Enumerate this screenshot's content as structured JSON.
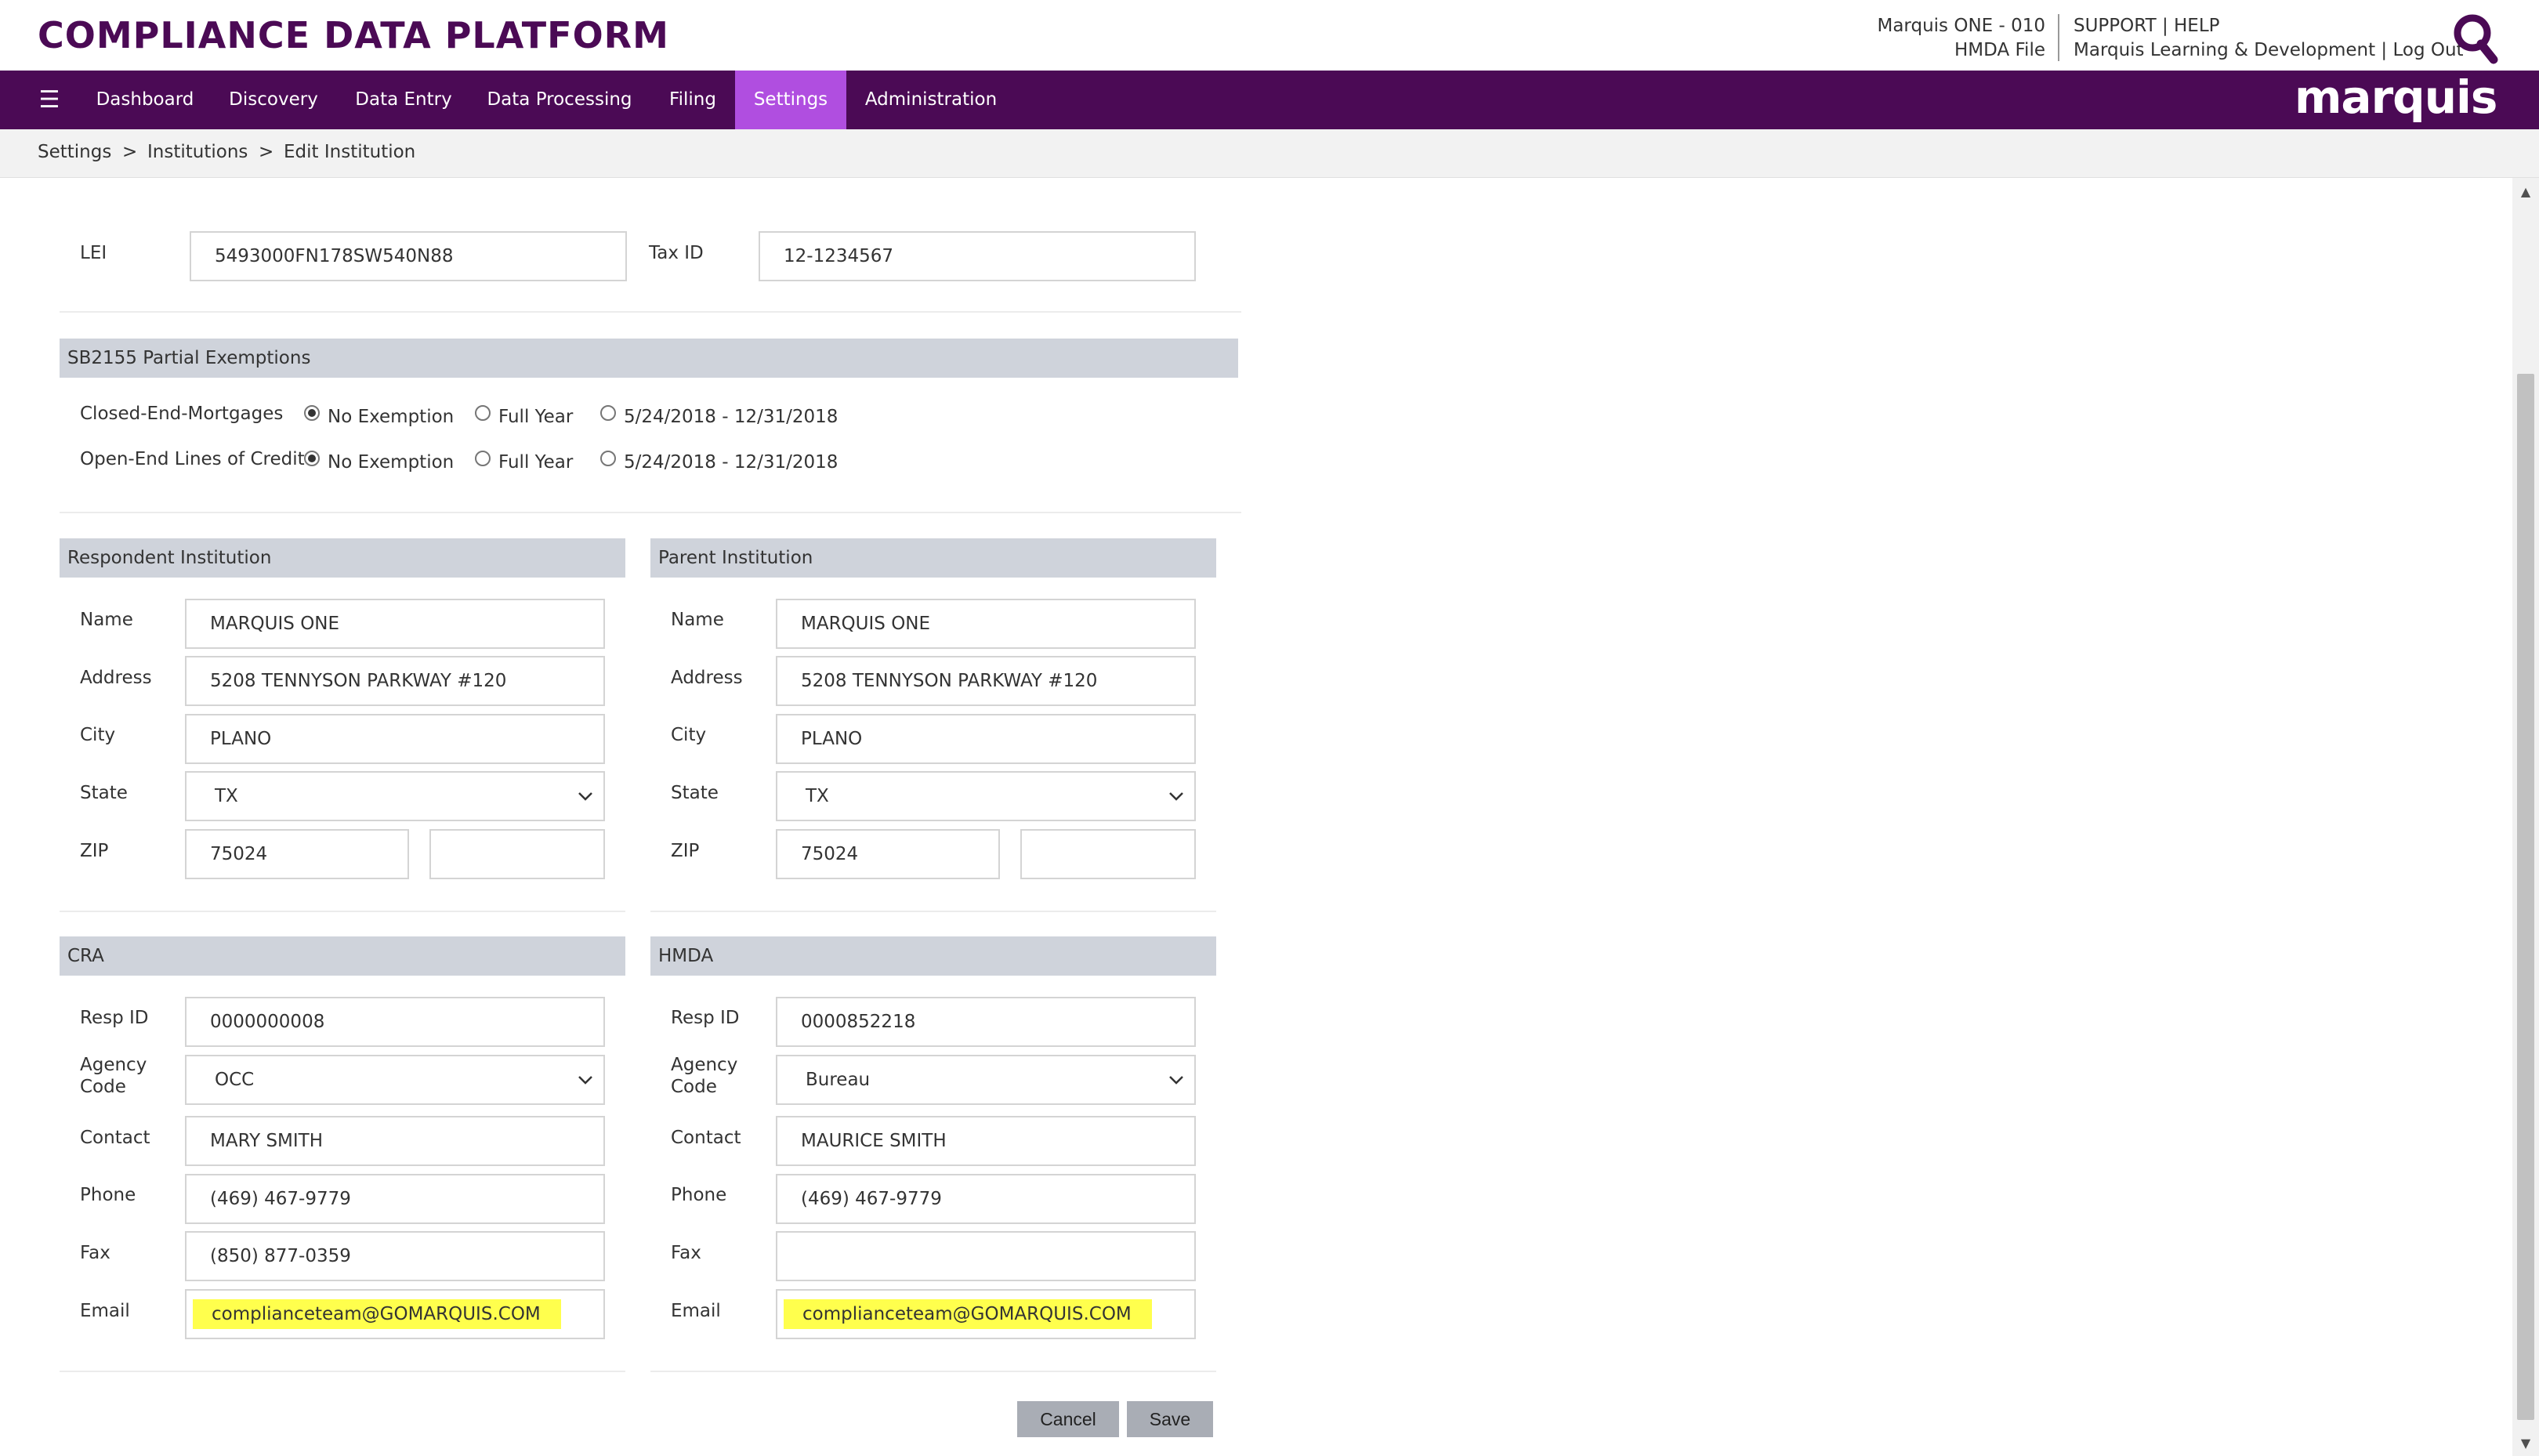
{
  "header": {
    "app_title": "COMPLIANCE DATA PLATFORM",
    "institution_line": "Marquis ONE - 010",
    "file_line": "HMDA File",
    "support_label": "SUPPORT",
    "help_label": "HELP",
    "user_label": "Marquis Learning & Development",
    "logout_label": "Log Out",
    "link_separator": "|",
    "brand": "marquis"
  },
  "nav": {
    "items": [
      {
        "label": "Dashboard"
      },
      {
        "label": "Discovery"
      },
      {
        "label": "Data Entry"
      },
      {
        "label": "Data Processing"
      },
      {
        "label": "Filing"
      },
      {
        "label": "Settings",
        "active": true
      },
      {
        "label": "Administration"
      }
    ]
  },
  "breadcrumb": {
    "items": [
      "Settings",
      "Institutions",
      "Edit Institution"
    ],
    "separator": ">"
  },
  "ids": {
    "lei_label": "LEI",
    "lei_value": "5493000FN178SW540N88",
    "tax_id_label": "Tax ID",
    "tax_id_value": "12-1234567"
  },
  "sb2155": {
    "title": "SB2155 Partial Exemptions",
    "rows": [
      {
        "label": "Closed-End-Mortgages",
        "options": [
          "No Exemption",
          "Full Year",
          "5/24/2018 - 12/31/2018"
        ],
        "selected": "No Exemption"
      },
      {
        "label": "Open-End Lines of Credit",
        "options": [
          "No Exemption",
          "Full Year",
          "5/24/2018 - 12/31/2018"
        ],
        "selected": "No Exemption"
      }
    ]
  },
  "respondent": {
    "title": "Respondent Institution",
    "name_label": "Name",
    "name": "MARQUIS ONE",
    "address_label": "Address",
    "address": "5208 TENNYSON PARKWAY #120",
    "city_label": "City",
    "city": "PLANO",
    "state_label": "State",
    "state": "TX",
    "zip_label": "ZIP",
    "zip": "75024",
    "zip_ext": ""
  },
  "parent": {
    "title": "Parent Institution",
    "name_label": "Name",
    "name": "MARQUIS ONE",
    "address_label": "Address",
    "address": "5208 TENNYSON PARKWAY #120",
    "city_label": "City",
    "city": "PLANO",
    "state_label": "State",
    "state": "TX",
    "zip_label": "ZIP",
    "zip": "75024",
    "zip_ext": ""
  },
  "cra": {
    "title": "CRA",
    "resp_id_label": "Resp ID",
    "resp_id": "0000000008",
    "agency_label_1": "Agency",
    "agency_label_2": "Code",
    "agency_code": "OCC",
    "contact_label": "Contact",
    "contact": "MARY SMITH",
    "phone_label": "Phone",
    "phone": "(469) 467-9779",
    "fax_label": "Fax",
    "fax": "(850) 877-0359",
    "email_label": "Email",
    "email": "complianceteam@GOMARQUIS.COM"
  },
  "hmda": {
    "title": "HMDA",
    "resp_id_label": "Resp ID",
    "resp_id": "0000852218",
    "agency_label_1": "Agency",
    "agency_label_2": "Code",
    "agency_code": "Bureau",
    "contact_label": "Contact",
    "contact": "MAURICE SMITH",
    "phone_label": "Phone",
    "phone": "(469) 467-9779",
    "fax_label": "Fax",
    "fax": "",
    "email_label": "Email",
    "email": "complianceteam@GOMARQUIS.COM"
  },
  "actions": {
    "cancel_label": "Cancel",
    "save_label": "Save"
  },
  "colors": {
    "brand_purple": "#4b0a55",
    "active_tab": "#b04ee0",
    "section_header": "#cfd3db",
    "highlight": "#ffff4d",
    "button": "#a9adb5"
  }
}
